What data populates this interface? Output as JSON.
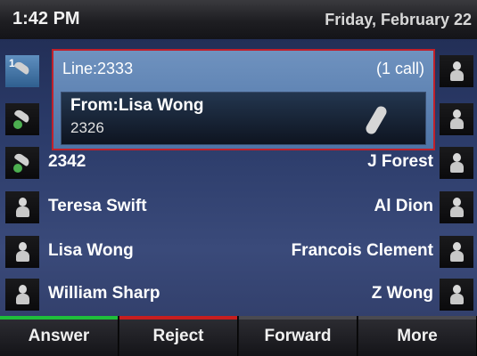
{
  "status": {
    "time": "1:42 PM",
    "date": "Friday, February 22"
  },
  "popup": {
    "line": "Line:2333",
    "calls": "(1 call)",
    "from": "From:Lisa Wong",
    "number": "2326"
  },
  "lines": {
    "line1_number": "1"
  },
  "rows": [
    {
      "left": "2342",
      "right": "J Forest"
    },
    {
      "left": "Teresa Swift",
      "right": "Al Dion"
    },
    {
      "left": "Lisa Wong",
      "right": "Francois Clement"
    },
    {
      "left": "William Sharp",
      "right": "Z Wong"
    }
  ],
  "softkeys": {
    "answer": "Answer",
    "reject": "Reject",
    "forward": "Forward",
    "more": "More"
  },
  "colors": {
    "answer": "#1fbf3a",
    "reject": "#c81e1e",
    "popup_border": "#c0202a"
  },
  "icons": {
    "line_icon": "handset-icon",
    "contact_icon": "person-icon"
  }
}
